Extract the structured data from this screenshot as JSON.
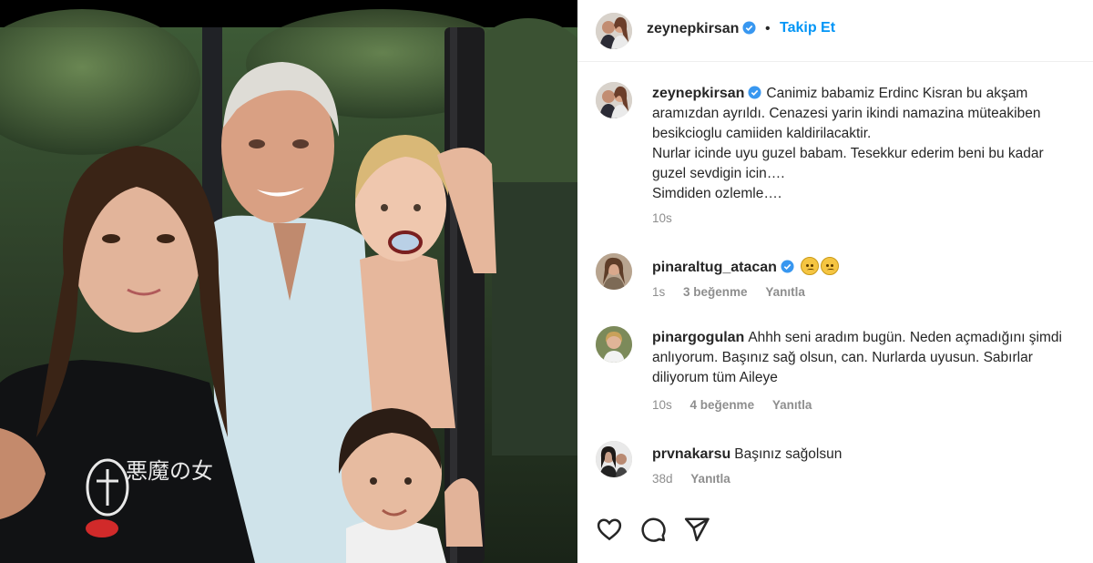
{
  "post": {
    "author": "zeynepkirsan",
    "separator": "•",
    "follow_label": "Takip Et",
    "photo_shirt_text": "悪魔の女"
  },
  "caption": {
    "username": "zeynepkirsan",
    "text": "Canimiz babamiz Erdinc Kisran bu akşam aramızdan ayrıldı. Cenazesi yarin ikindi namazina müteakiben besikcioglu camiiden kaldirilacaktir.\nNurlar icinde uyu guzel babam. Tesekkur ederim beni bu kadar guzel sevdigin icin….\nSimdiden ozlemle….",
    "time": "10s"
  },
  "comments": [
    {
      "username": "pinaraltug_atacan",
      "emoji_count": 2,
      "emoji_name": "sad-face",
      "time": "1s",
      "likes": "3 beğenme",
      "reply": "Yanıtla"
    },
    {
      "username": "pinargogulan",
      "text": "Ahhh seni aradım bugün. Neden açmadığını şimdi anlıyorum. Başınız sağ olsun, can. Nurlarda uyusun. Sabırlar diliyorum tüm Aileye",
      "time": "10s",
      "likes": "4 beğenme",
      "reply": "Yanıtla"
    },
    {
      "username": "prvnakarsu",
      "text": "Başınız sağolsun",
      "time": "38d",
      "reply": "Yanıtla"
    }
  ],
  "icons": {
    "verified": "verified-badge-icon",
    "like": "heart-icon",
    "comment": "comment-bubble-icon",
    "share": "paper-plane-icon"
  },
  "colors": {
    "accent": "#0095f6",
    "text": "#262626",
    "muted": "#8e8e8e",
    "verified": "#3897f0"
  }
}
